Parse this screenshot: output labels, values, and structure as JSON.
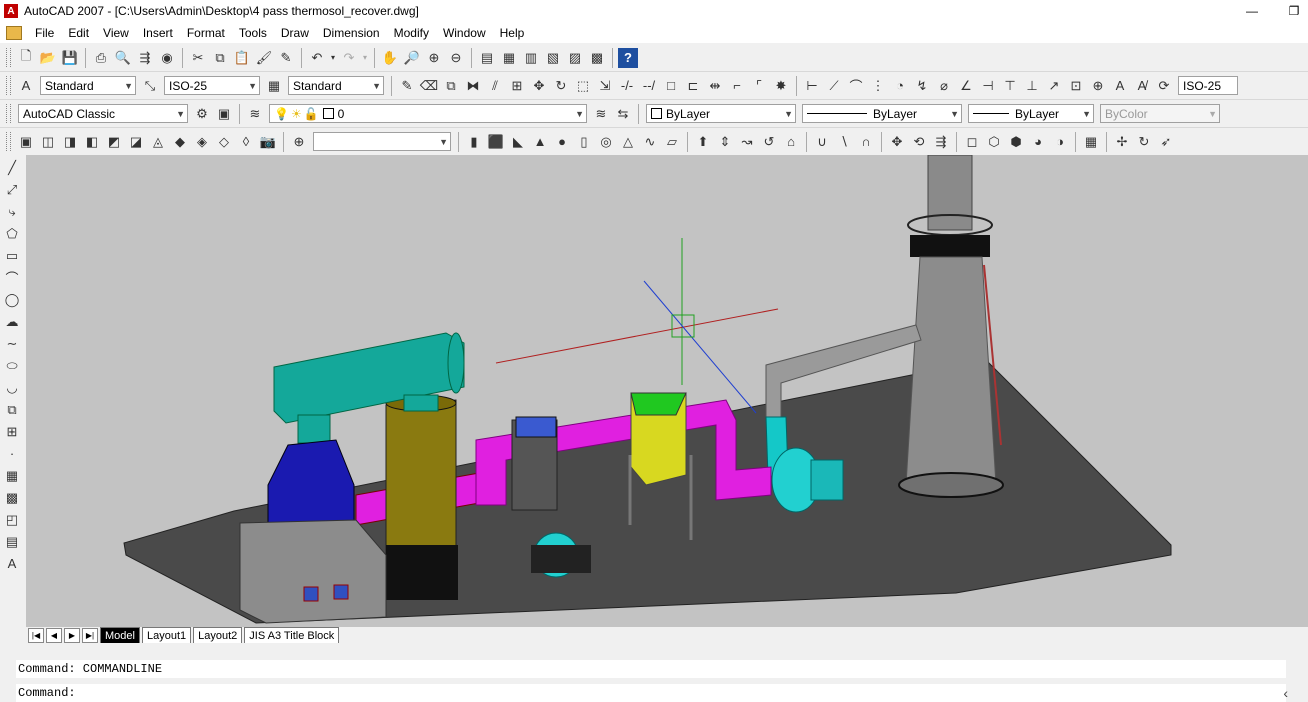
{
  "window": {
    "title": "AutoCAD 2007 - [C:\\Users\\Admin\\Desktop\\4 pass thermosol_recover.dwg]",
    "minimize_glyph": "—",
    "restore_glyph": "❐"
  },
  "menu": [
    "File",
    "Edit",
    "View",
    "Insert",
    "Format",
    "Tools",
    "Draw",
    "Dimension",
    "Modify",
    "Window",
    "Help"
  ],
  "styles": {
    "text_style": "Standard",
    "dim_style": "ISO-25",
    "table_style": "Standard",
    "dim_style_right": "ISO-25"
  },
  "workspace": "AutoCAD Classic",
  "layers": {
    "current_layer": "0",
    "color": "ByLayer",
    "linetype": "ByLayer",
    "lineweight": "ByLayer",
    "plotstyle": "ByColor"
  },
  "tabs": [
    {
      "label": "Model",
      "active": true
    },
    {
      "label": "Layout1",
      "active": false
    },
    {
      "label": "Layout2",
      "active": false
    },
    {
      "label": "JIS A3 Title Block",
      "active": false
    }
  ],
  "command": {
    "history": "Command: COMMANDLINE",
    "prompt": "Command:"
  },
  "colors": {
    "viewport_bg": "#c3c3c3",
    "teal": "#14a89a",
    "magenta": "#e020e0",
    "blue": "#1a1ab0",
    "olive": "#8a7a10",
    "yellow": "#d8d820",
    "cyan": "#20c8c8"
  }
}
